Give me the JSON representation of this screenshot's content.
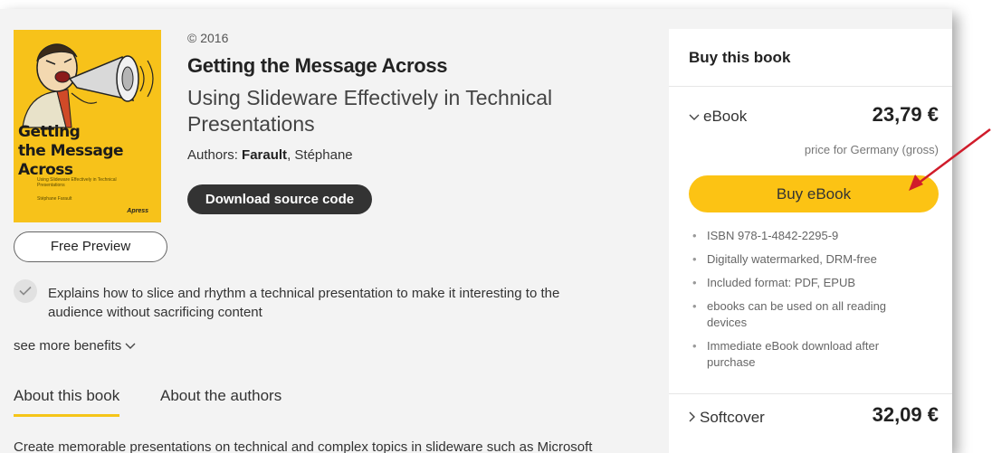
{
  "book": {
    "copyright": "© 2016",
    "title": "Getting the Message Across",
    "subtitle": "Using Slideware Effectively in Technical Presentations",
    "authors_label": "Authors:",
    "author_primary": "Farault",
    "author_rest": ", Stéphane",
    "cover": {
      "title_lines": [
        "Getting",
        "the Message",
        "Across"
      ],
      "subtitle": "Using Slideware Effectively in Technical Presentations",
      "author": "Stéphane Farault",
      "publisher": "Apress"
    }
  },
  "actions": {
    "download_label": "Download source code",
    "preview_label": "Free Preview"
  },
  "benefits": {
    "items": [
      "Explains how to slice and rhythm a technical presentation to make it interesting to the audience without sacrificing content"
    ],
    "see_more_label": "see more benefits"
  },
  "tabs": [
    {
      "label": "About this book",
      "active": true
    },
    {
      "label": "About the authors",
      "active": false
    }
  ],
  "description_preview": "Create memorable presentations on technical and complex topics in slideware such as Microsoft",
  "buy": {
    "header": "Buy this book",
    "ebook": {
      "label": "eBook",
      "price": "23,79 €",
      "price_note": "price for Germany (gross)",
      "button_label": "Buy eBook",
      "features": [
        "ISBN 978-1-4842-2295-9",
        "Digitally watermarked, DRM-free",
        "Included format: PDF, EPUB",
        "ebooks can be used on all reading devices",
        "Immediate eBook download after purchase"
      ]
    },
    "softcover": {
      "label": "Softcover",
      "price": "32,09 €"
    }
  },
  "colors": {
    "accent_yellow": "#fcc314",
    "annotation_arrow": "#d01c2b",
    "dark_button": "#333333"
  }
}
